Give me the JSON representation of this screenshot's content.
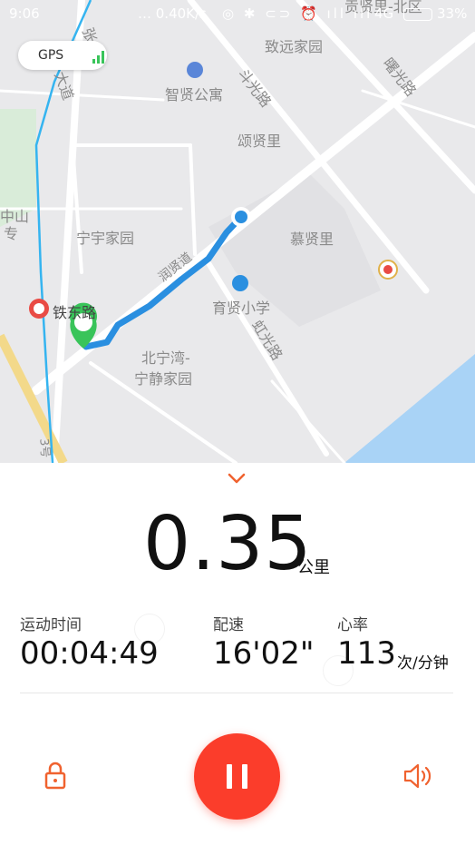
{
  "status_bar": {
    "time": "9:06",
    "network_speed": "… 0.40K/s",
    "icons_text": "◎ ✱ ⊂⊃ ⏰ ıll ıll",
    "network_type": "4G",
    "battery": "33%"
  },
  "gps": {
    "label": "GPS",
    "signal_color": "#39c45a"
  },
  "map": {
    "places": {
      "zhiyuan": "致远家园",
      "zhixian": "智贤公寓",
      "songxianli": "颂贤里",
      "muxianli": "慕贤里",
      "ningyu": "宁宇家园",
      "yuxian": "育贤小学",
      "beiningwan": "北宁湾-",
      "ningjing": "宁静家园",
      "tiedonglu": "铁东路",
      "zhongshan": "中山",
      "zhuan": "专",
      "gongxianli": "贡贤里-北区"
    },
    "roads": {
      "douguang": "斗光路",
      "shuguang": "曙光路",
      "hongguang": "虹光路",
      "runxian": "润贤道",
      "dadao": "大道",
      "zhang": "张",
      "line3": "3号"
    },
    "route_color": "#2a8fe0"
  },
  "stats": {
    "distance_value": "0.35",
    "distance_unit": "公里",
    "duration_label": "运动时间",
    "duration_value": "00:04:49",
    "pace_label": "配速",
    "pace_value": "16'02\"",
    "heart_label": "心率",
    "heart_value": "113",
    "heart_unit": "次/分钟"
  },
  "controls": {
    "collapse_icon": "chevron-down-icon",
    "lock_icon": "lock-icon",
    "pause_icon": "pause-icon",
    "sound_icon": "speaker-icon",
    "accent_color": "#f0622f",
    "pause_color": "#fb3d2b"
  }
}
